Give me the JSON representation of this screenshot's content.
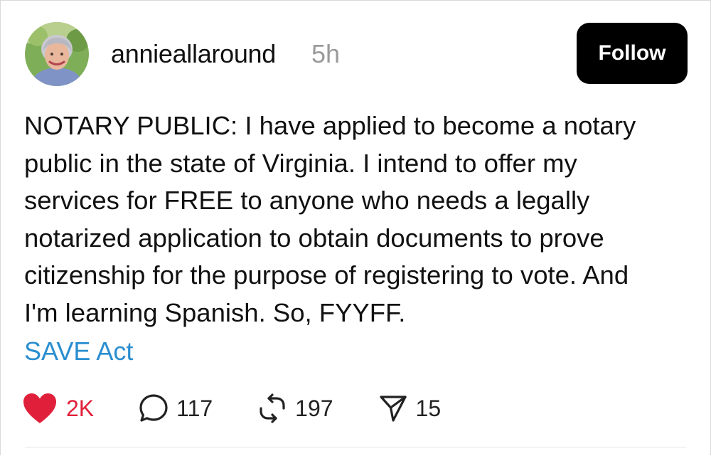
{
  "post": {
    "author": {
      "username": "annieallaround",
      "timestamp": "5h"
    },
    "follow_label": "Follow",
    "text": "NOTARY PUBLIC: I have applied to become a notary\npublic in the state of Virginia. I intend to offer my\nservices for FREE to anyone who needs a legally\nnotarized application to obtain documents to prove\ncitizenship for the purpose of registering to vote. And\nI'm learning Spanish. So, FYYFF.",
    "tag": "SAVE Act",
    "actions": {
      "likes": "2K",
      "replies": "117",
      "reposts": "197",
      "shares": "15"
    },
    "icons": {
      "like": "heart-icon",
      "reply": "speech-bubble-icon",
      "repost": "repost-arrows-icon",
      "share": "send-paper-plane-icon"
    },
    "colors": {
      "like_active": "#e0203a",
      "tag_link": "#2a8ed0",
      "follow_bg": "#000000",
      "timestamp": "#9a9a9a"
    }
  }
}
